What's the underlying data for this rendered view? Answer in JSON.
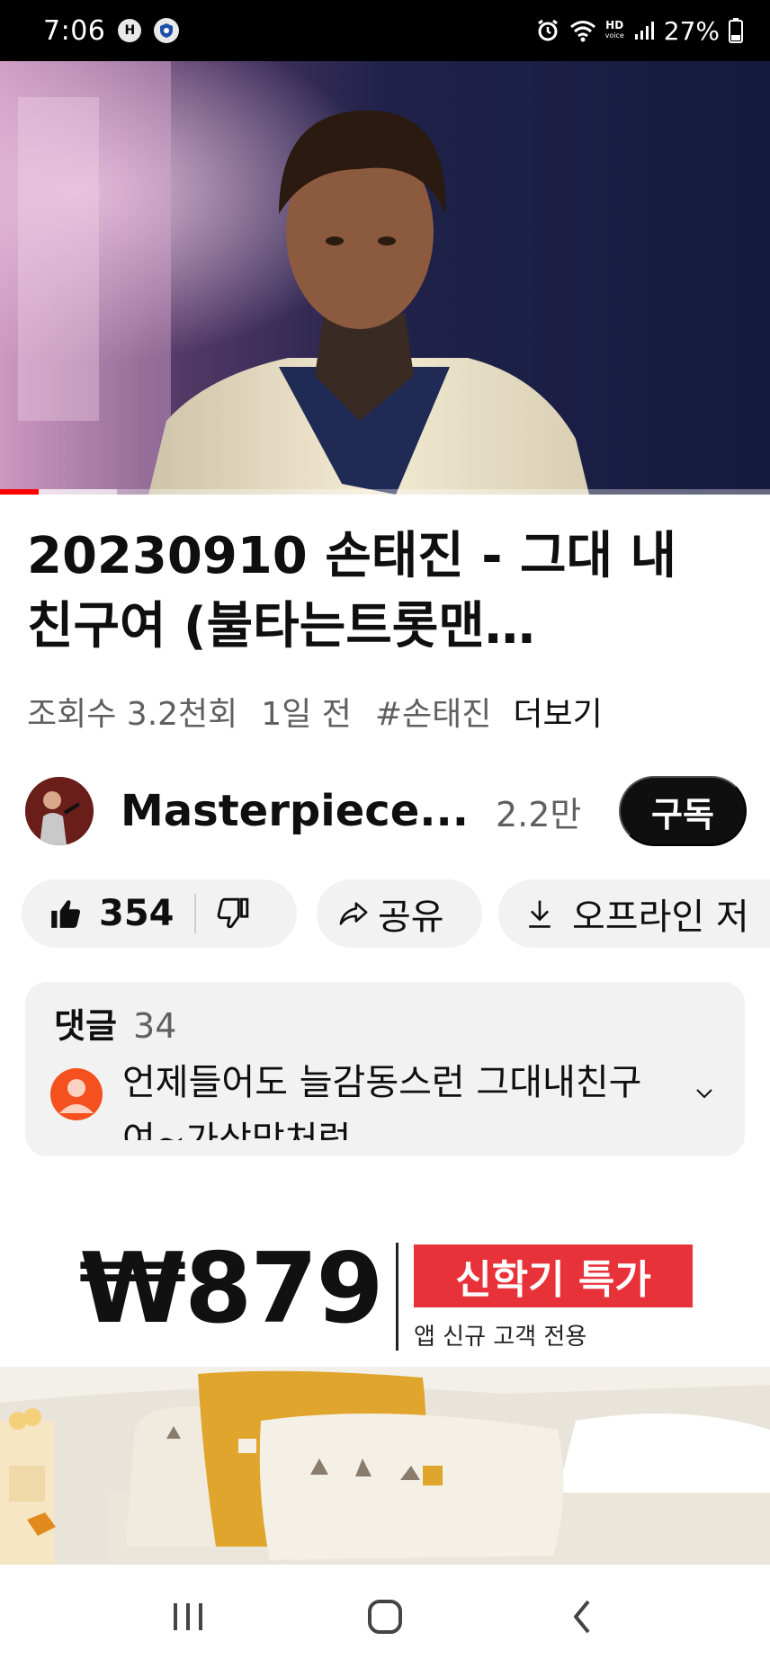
{
  "status_bar": {
    "time": "7:06",
    "left_badges": [
      "H",
      "shield"
    ],
    "icons": [
      "alarm-icon",
      "wifi-icon",
      "hd-voice-icon",
      "signal-icon",
      "battery-icon"
    ],
    "hd_label": "HD",
    "voice_label": "voice",
    "battery_percent": "27%"
  },
  "player": {
    "played_fraction": 0.05,
    "buffered_fraction": 0.152,
    "accent": "#ff0000"
  },
  "video": {
    "title": "20230910 손태진 - 그대 내 친구여 (불타는트롯맨…",
    "views": "조회수 3.2천회",
    "age": "1일 전",
    "hashtag": "#손태진",
    "more": "더보기"
  },
  "channel": {
    "name": "Masterpiece...",
    "subscribers": "2.2만",
    "subscribe_label": "구독"
  },
  "actions": {
    "like_count": "354",
    "share_label": "공유",
    "offline_label": "오프라인 저"
  },
  "comments": {
    "label": "댓글",
    "count": "34",
    "top_comment": "언제들어도 늘감동스런 그대내친구여~가삼맙처럼"
  },
  "ad": {
    "price": "₩879",
    "tag": "신학기 특가",
    "subtitle": "앱 신규 고객 전용",
    "accent": "#e8323a"
  },
  "nav": {
    "buttons": [
      "recents-icon",
      "home-icon",
      "back-icon"
    ]
  }
}
